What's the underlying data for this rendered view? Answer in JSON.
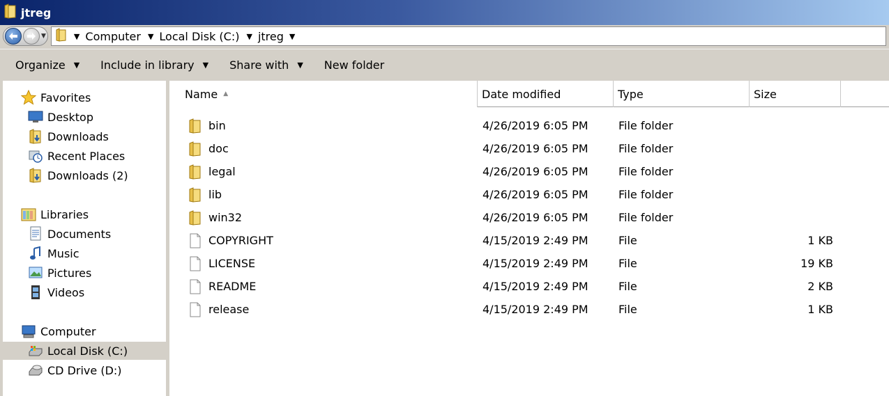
{
  "window": {
    "title": "jtreg"
  },
  "address": {
    "crumbs": [
      {
        "label": "Computer"
      },
      {
        "label": "Local Disk (C:)"
      },
      {
        "label": "jtreg"
      }
    ]
  },
  "toolbar": {
    "organize": "Organize",
    "include_in_library": "Include in library",
    "share_with": "Share with",
    "new_folder": "New folder"
  },
  "nav": {
    "favorites": {
      "label": "Favorites",
      "items": [
        {
          "label": "Desktop",
          "icon": "desktop-icon"
        },
        {
          "label": "Downloads",
          "icon": "downloads-folder-icon"
        },
        {
          "label": "Recent Places",
          "icon": "recent-places-icon"
        },
        {
          "label": "Downloads (2)",
          "icon": "downloads-folder-icon"
        }
      ]
    },
    "libraries": {
      "label": "Libraries",
      "items": [
        {
          "label": "Documents",
          "icon": "documents-icon"
        },
        {
          "label": "Music",
          "icon": "music-icon"
        },
        {
          "label": "Pictures",
          "icon": "pictures-icon"
        },
        {
          "label": "Videos",
          "icon": "videos-icon"
        }
      ]
    },
    "computer": {
      "label": "Computer",
      "items": [
        {
          "label": "Local Disk (C:)",
          "icon": "local-disk-icon",
          "selected": true
        },
        {
          "label": "CD Drive (D:)",
          "icon": "cd-drive-icon"
        }
      ]
    }
  },
  "columns": {
    "name": "Name",
    "date_modified": "Date modified",
    "type": "Type",
    "size": "Size"
  },
  "files": [
    {
      "name": "bin",
      "date": "4/26/2019 6:05 PM",
      "type": "File folder",
      "size": "",
      "kind": "folder"
    },
    {
      "name": "doc",
      "date": "4/26/2019 6:05 PM",
      "type": "File folder",
      "size": "",
      "kind": "folder"
    },
    {
      "name": "legal",
      "date": "4/26/2019 6:05 PM",
      "type": "File folder",
      "size": "",
      "kind": "folder"
    },
    {
      "name": "lib",
      "date": "4/26/2019 6:05 PM",
      "type": "File folder",
      "size": "",
      "kind": "folder"
    },
    {
      "name": "win32",
      "date": "4/26/2019 6:05 PM",
      "type": "File folder",
      "size": "",
      "kind": "folder"
    },
    {
      "name": "COPYRIGHT",
      "date": "4/15/2019 2:49 PM",
      "type": "File",
      "size": "1 KB",
      "kind": "file"
    },
    {
      "name": "LICENSE",
      "date": "4/15/2019 2:49 PM",
      "type": "File",
      "size": "19 KB",
      "kind": "file"
    },
    {
      "name": "README",
      "date": "4/15/2019 2:49 PM",
      "type": "File",
      "size": "2 KB",
      "kind": "file"
    },
    {
      "name": "release",
      "date": "4/15/2019 2:49 PM",
      "type": "File",
      "size": "1 KB",
      "kind": "file"
    }
  ]
}
